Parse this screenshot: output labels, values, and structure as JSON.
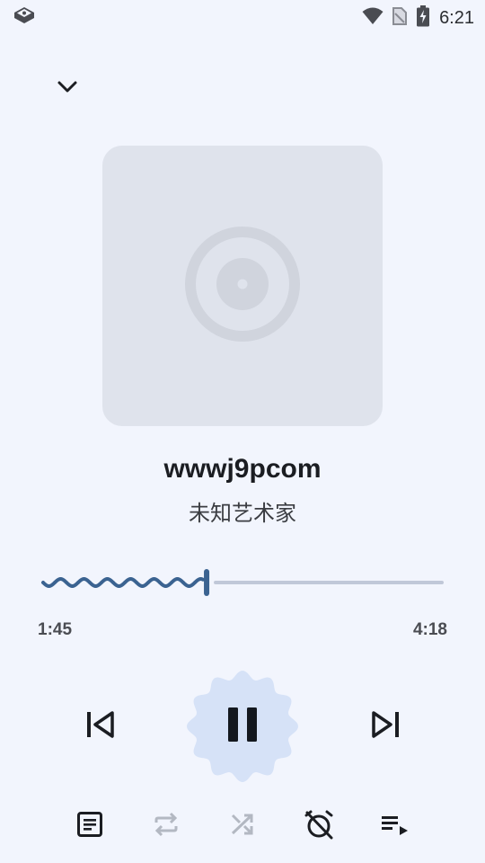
{
  "status_bar": {
    "time": "6:21",
    "icons": [
      "notification-app-icon",
      "wifi-icon",
      "no-sim-icon",
      "battery-charging-icon"
    ]
  },
  "player": {
    "collapse_icon": "chevron-down-icon",
    "album_art_icon": "disc-placeholder-icon",
    "title": "wwwj9pcom",
    "artist": "未知艺术家",
    "progress": {
      "current": "1:45",
      "total": "4:18",
      "fraction": 0.41
    }
  },
  "controls": {
    "prev_icon": "skip-previous-icon",
    "play_pause_icon": "pause-icon",
    "next_icon": "skip-next-icon",
    "lyrics_icon": "lyrics-icon",
    "repeat_icon": "repeat-icon",
    "shuffle_icon": "shuffle-icon",
    "sleep_timer_icon": "alarm-off-icon",
    "queue_icon": "queue-music-icon",
    "repeat_enabled": false,
    "shuffle_enabled": false
  },
  "colors": {
    "background": "#f2f5fd",
    "accent": "#3b6391",
    "track_inactive": "#c0c8d8",
    "play_button_bg": "#d6e2f7",
    "album_bg": "#dfe3ec",
    "disabled_icon": "#b3b8c2"
  }
}
